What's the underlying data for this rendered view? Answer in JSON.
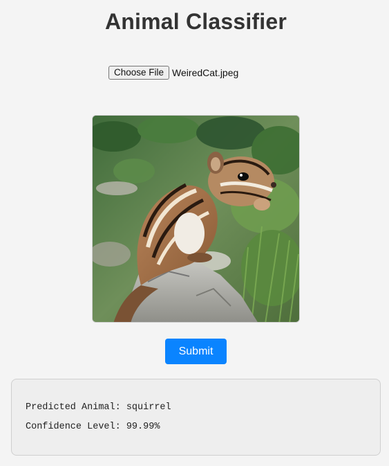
{
  "page": {
    "title": "Animal Classifier"
  },
  "upload": {
    "choose_label": "Choose File",
    "file_name": "WeiredCat.jpeg"
  },
  "preview": {
    "subject": "chipmunk-photo"
  },
  "actions": {
    "submit_label": "Submit"
  },
  "result": {
    "predicted_text": "Predicted Animal: squirrel",
    "confidence_text": "Confidence Level: 99.99%"
  },
  "colors": {
    "background": "#f4f4f4",
    "accent": "#0a84ff",
    "result_panel": "#eeeeee"
  }
}
